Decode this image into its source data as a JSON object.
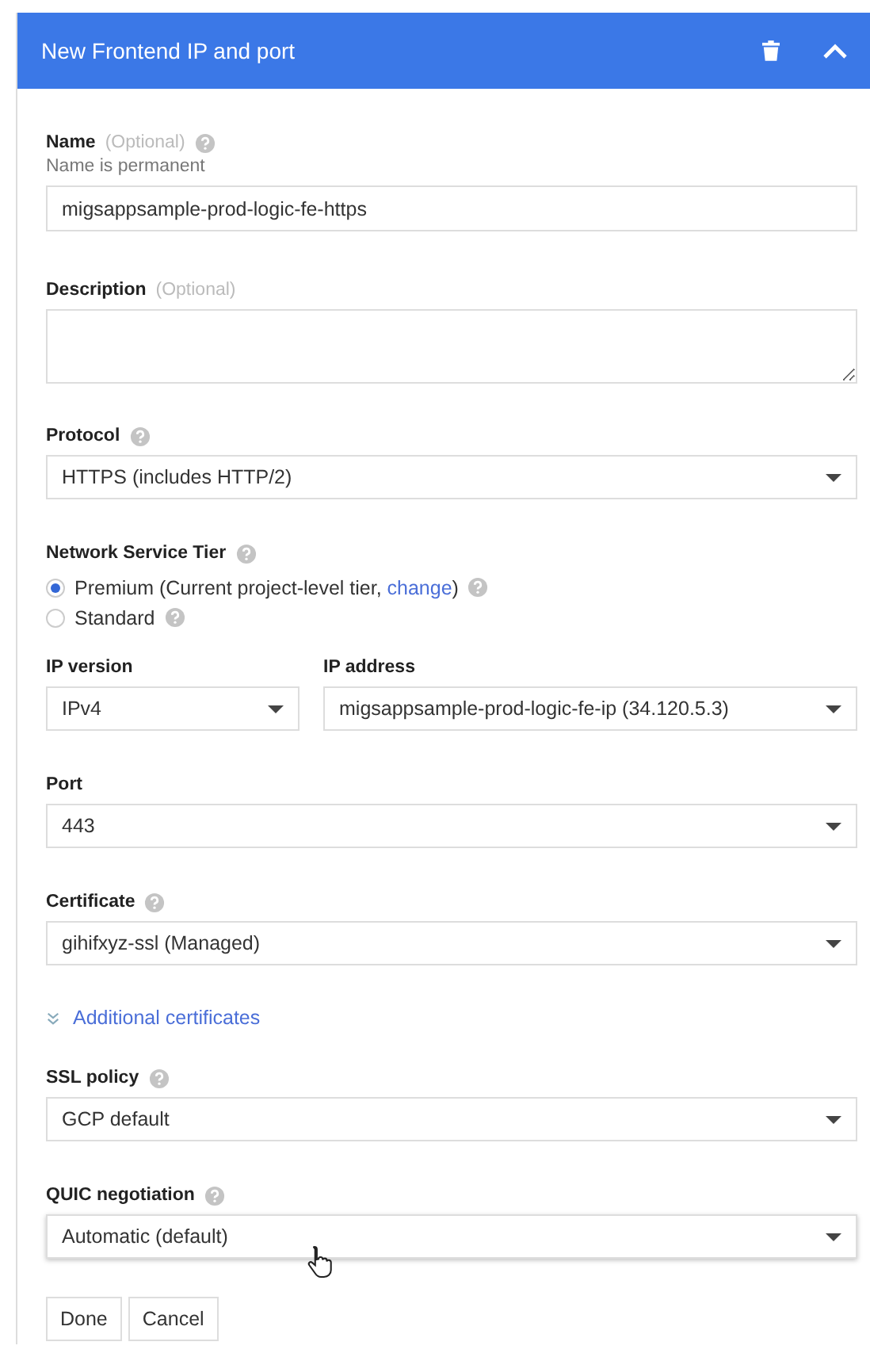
{
  "panel": {
    "title": "New Frontend IP and port"
  },
  "fields": [
    {
      "kind": "text",
      "label": "Name",
      "optional": "(Optional)",
      "help": true,
      "hint": "Name is permanent",
      "value": "migsappsample-prod-logic-fe-https"
    },
    {
      "kind": "textarea",
      "label": "Description",
      "optional": "(Optional)",
      "help": false
    },
    {
      "kind": "select",
      "label": "Protocol",
      "help": true,
      "value": "HTTPS (includes HTTP/2)"
    },
    {
      "kind": "radio",
      "label": "Network Service Tier",
      "help": true,
      "options": [
        {
          "label": "Premium (Current project-level tier, ",
          "link": "change",
          "after": ")",
          "selected": true,
          "help": true
        },
        {
          "label": "Standard",
          "selected": false,
          "help": true
        }
      ]
    },
    {
      "kind": "pair",
      "items": [
        {
          "label": "IP version",
          "value": "IPv4"
        },
        {
          "label": "IP address",
          "value": "migsappsample-prod-logic-fe-ip (34.120.5.3)"
        }
      ]
    },
    {
      "kind": "select",
      "label": "Port",
      "help": false,
      "value": "443"
    },
    {
      "kind": "select",
      "label": "Certificate",
      "help": true,
      "value": "gihifxyz-ssl (Managed)"
    },
    {
      "kind": "link",
      "label": "Additional certificates"
    },
    {
      "kind": "select",
      "label": "SSL policy",
      "help": true,
      "value": "GCP default"
    },
    {
      "kind": "select",
      "label": "QUIC negotiation",
      "help": true,
      "value": "Automatic (default)",
      "hovered": true
    }
  ],
  "buttons": [
    "Done",
    "Cancel"
  ]
}
